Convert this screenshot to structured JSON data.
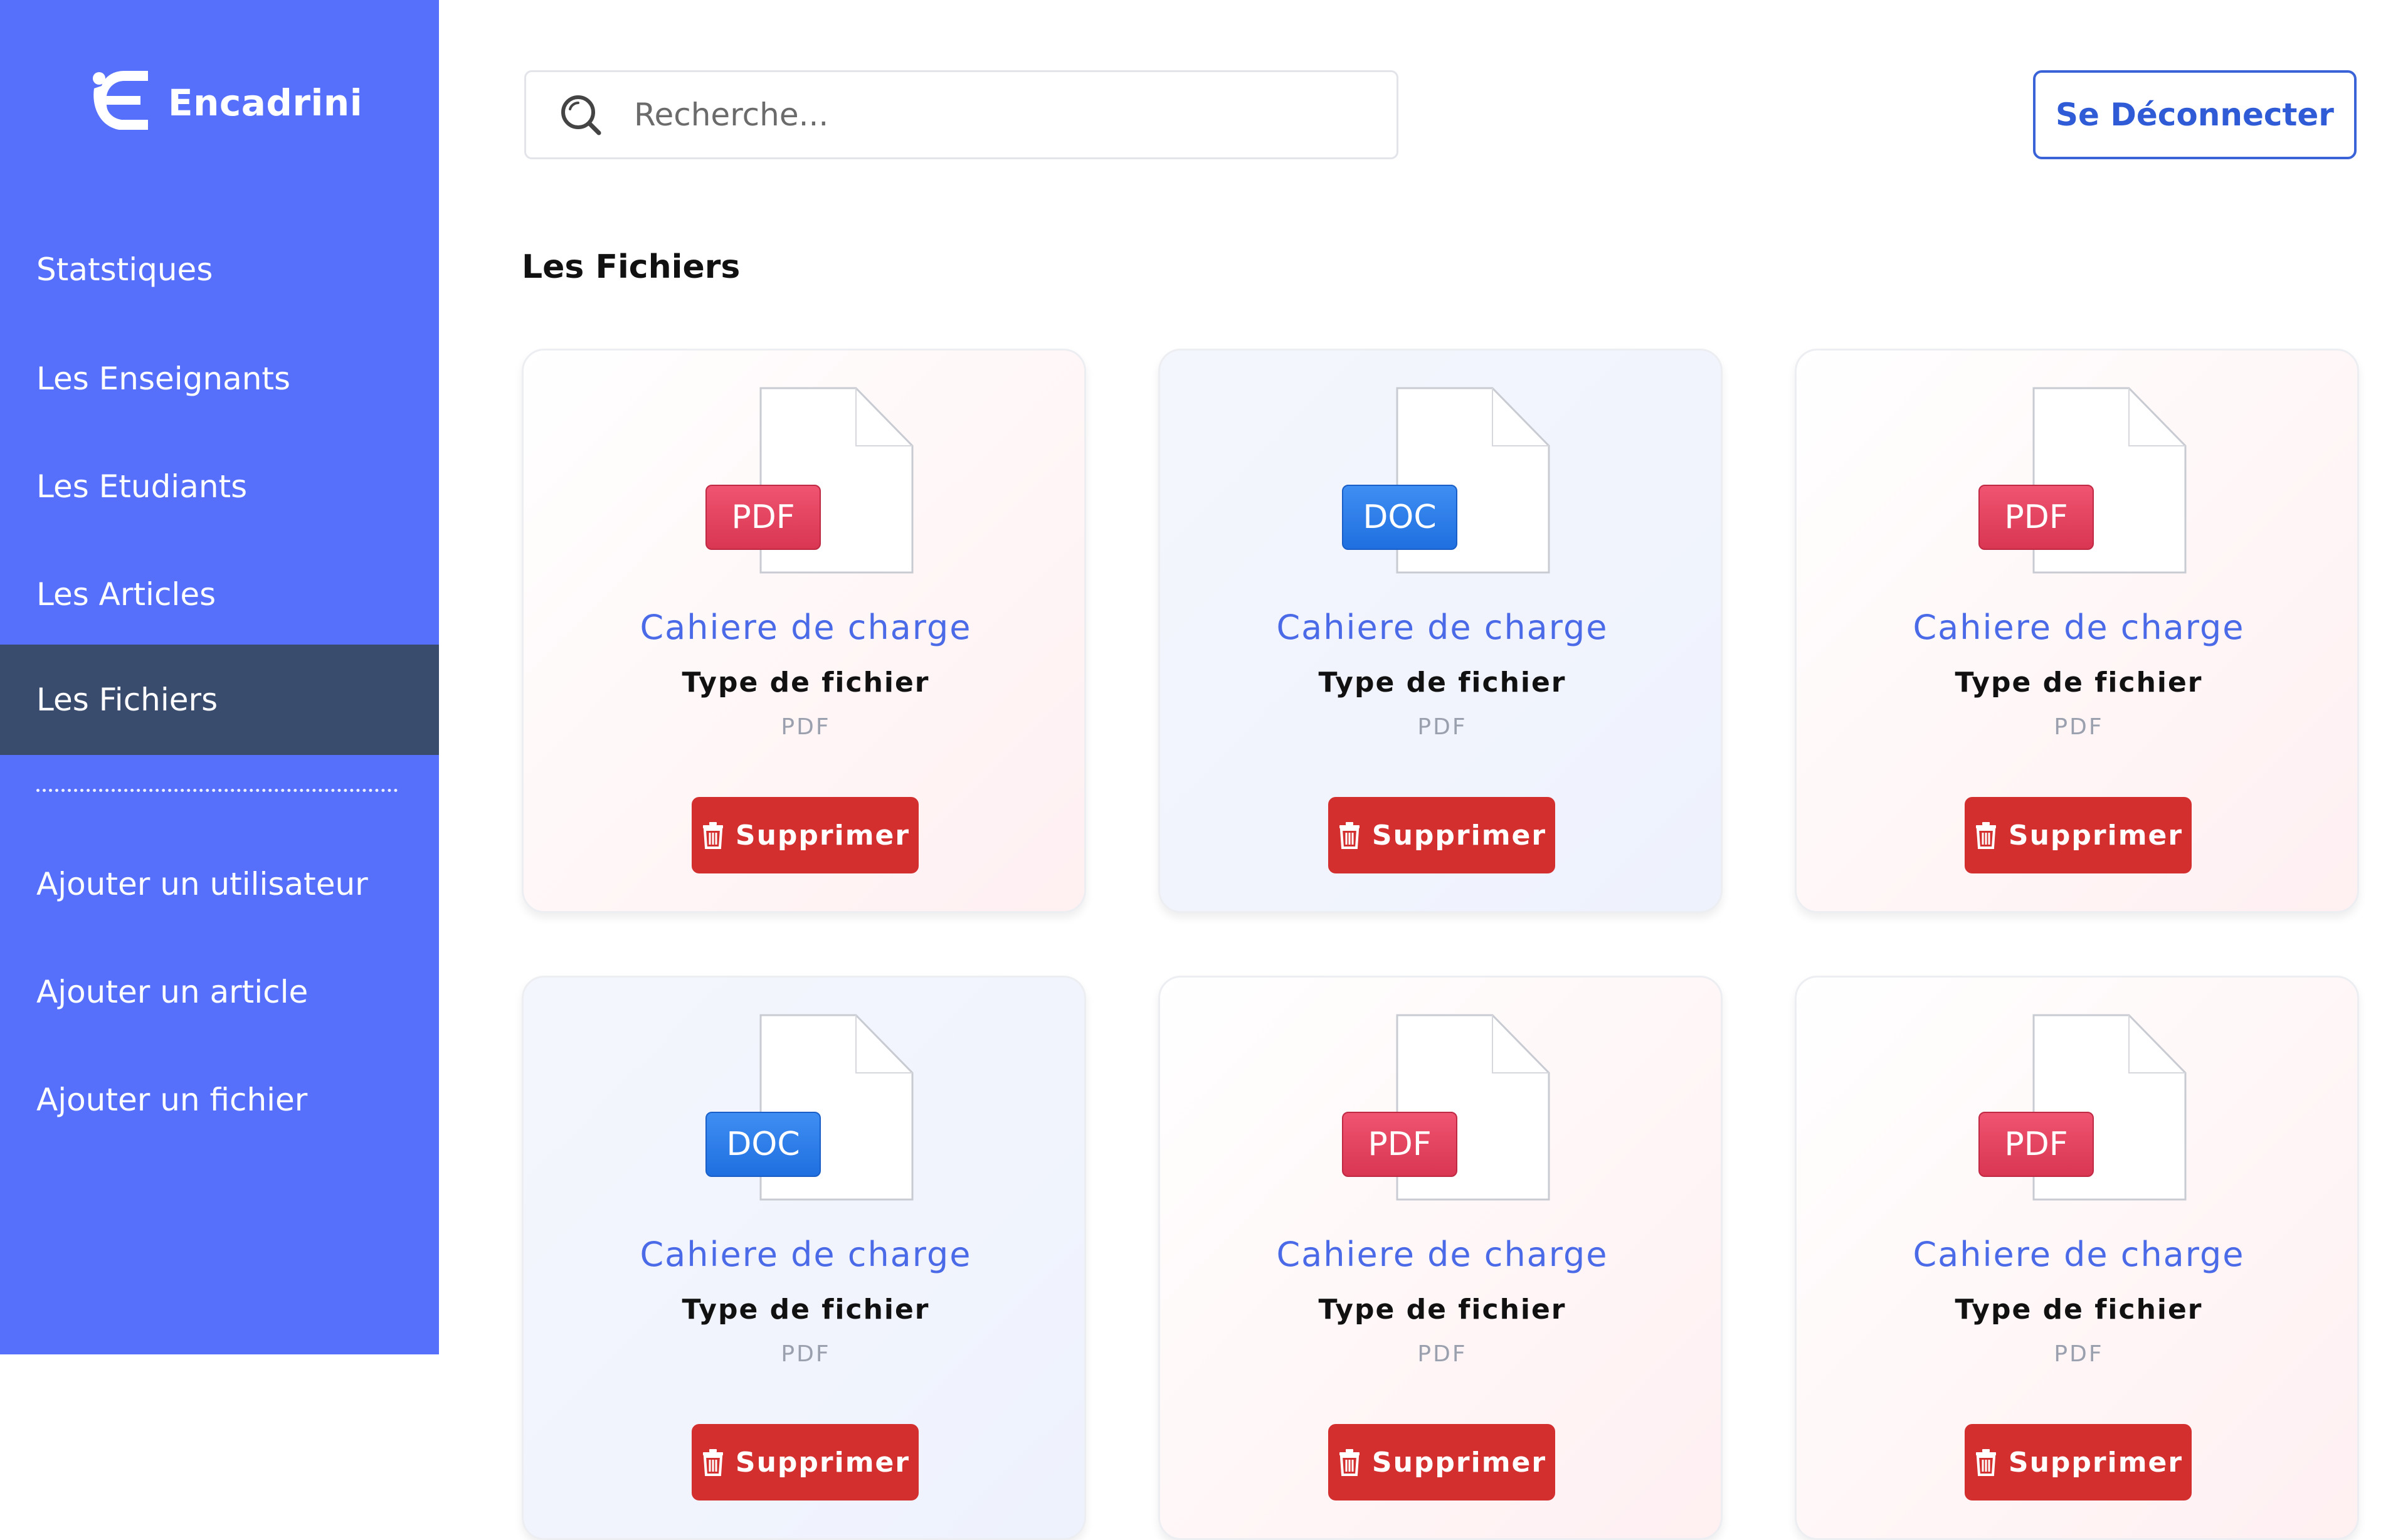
{
  "brand": {
    "name": "Encadrini"
  },
  "sidebar": {
    "items": [
      {
        "label": "Statstiques"
      },
      {
        "label": "Les Enseignants"
      },
      {
        "label": "Les Etudiants"
      },
      {
        "label": "Les Articles"
      },
      {
        "label": "Les Fichiers",
        "active": true
      }
    ],
    "actions": [
      {
        "label": "Ajouter un utilisateur"
      },
      {
        "label": "Ajouter un article"
      },
      {
        "label": "Ajouter un fichier"
      }
    ]
  },
  "search": {
    "placeholder": "Recherche..."
  },
  "header": {
    "logout_label": "Se Déconnecter"
  },
  "main": {
    "title": "Les Fichiers",
    "cards": [
      {
        "badge": "PDF",
        "kind": "pdf",
        "title": "Cahiere de charge",
        "type_label": "Type de fichier",
        "type_value": "PDF",
        "delete_label": "Supprimer"
      },
      {
        "badge": "DOC",
        "kind": "doc",
        "title": "Cahiere de charge",
        "type_label": "Type de fichier",
        "type_value": "PDF",
        "delete_label": "Supprimer"
      },
      {
        "badge": "PDF",
        "kind": "pdf",
        "title": "Cahiere de charge",
        "type_label": "Type de fichier",
        "type_value": "PDF",
        "delete_label": "Supprimer"
      },
      {
        "badge": "DOC",
        "kind": "doc",
        "title": "Cahiere de charge",
        "type_label": "Type de fichier",
        "type_value": "PDF",
        "delete_label": "Supprimer"
      },
      {
        "badge": "PDF",
        "kind": "pdf",
        "title": "Cahiere de charge",
        "type_label": "Type de fichier",
        "type_value": "PDF",
        "delete_label": "Supprimer"
      },
      {
        "badge": "PDF",
        "kind": "pdf",
        "title": "Cahiere de charge",
        "type_label": "Type de fichier",
        "type_value": "PDF",
        "delete_label": "Supprimer"
      }
    ]
  },
  "colors": {
    "sidebar": "#5670fb",
    "sidebar_active": "#3a4c6e",
    "accent": "#4b6ae8",
    "danger": "#d32f2f",
    "pdf_badge": "#e44160",
    "doc_badge": "#2f7ee8"
  },
  "icons": {
    "brand": "encadrini-logo-icon",
    "search": "search-icon",
    "file": "document-icon",
    "delete": "trash-icon"
  }
}
